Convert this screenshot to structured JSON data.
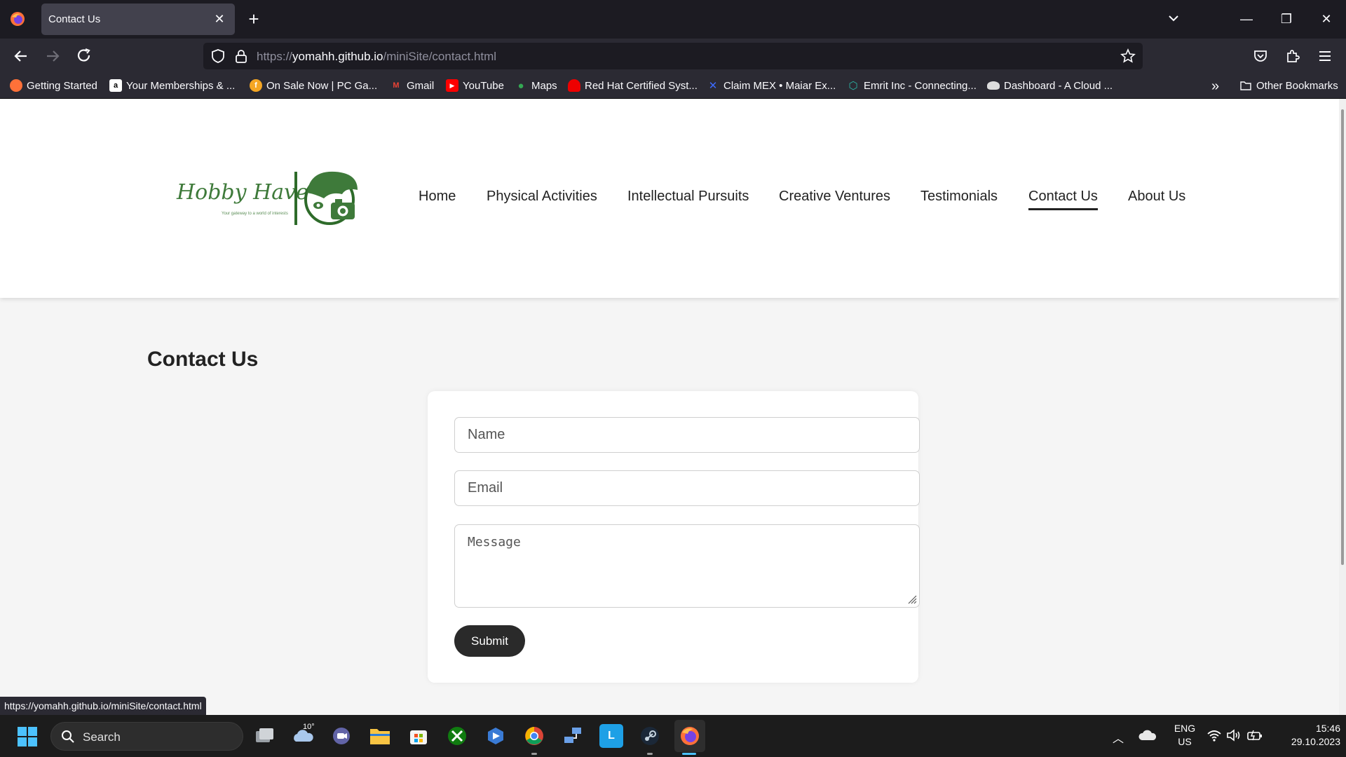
{
  "browser": {
    "tab_title": "Contact Us",
    "url_prefix": "https://",
    "url_host": "yomahh.github.io",
    "url_path": "/miniSite/contact.html",
    "bookmarks": [
      {
        "label": "Getting Started",
        "icon": "firefox-icon",
        "color": "#e66000"
      },
      {
        "label": "Your Memberships & ...",
        "icon": "amazon-icon",
        "color": "#ffffff"
      },
      {
        "label": "On Sale Now | PC Ga...",
        "icon": "store-icon",
        "color": "#f5a623"
      },
      {
        "label": "Gmail",
        "icon": "gmail-icon",
        "color": "#ea4335"
      },
      {
        "label": "YouTube",
        "icon": "youtube-icon",
        "color": "#ff0000"
      },
      {
        "label": "Maps",
        "icon": "maps-icon",
        "color": "#34a853"
      },
      {
        "label": "Red Hat Certified Syst...",
        "icon": "redhat-icon",
        "color": "#ee0000"
      },
      {
        "label": "Claim MEX • Maiar Ex...",
        "icon": "maiar-icon",
        "color": "#1a4fff"
      },
      {
        "label": "Emrit Inc - Connecting...",
        "icon": "emrit-icon",
        "color": "#2bb3a3"
      },
      {
        "label": "Dashboard - A Cloud ...",
        "icon": "cloud-icon",
        "color": "#dddddd"
      }
    ],
    "other_bookmarks": "Other Bookmarks",
    "status_url": "https://yomahh.github.io/miniSite/contact.html"
  },
  "site": {
    "logo_text": "Hobby Haven",
    "logo_tagline": "Your gateway to a world of interests",
    "nav": [
      {
        "label": "Home",
        "active": false
      },
      {
        "label": "Physical Activities",
        "active": false
      },
      {
        "label": "Intellectual Pursuits",
        "active": false
      },
      {
        "label": "Creative Ventures",
        "active": false
      },
      {
        "label": "Testimonials",
        "active": false
      },
      {
        "label": "Contact Us",
        "active": true
      },
      {
        "label": "About Us",
        "active": false
      }
    ],
    "page_title": "Contact Us",
    "form": {
      "name_placeholder": "Name",
      "email_placeholder": "Email",
      "message_placeholder": "Message",
      "submit_label": "Submit"
    },
    "brand_color": "#3e7a3a"
  },
  "taskbar": {
    "search_label": "Search",
    "weather_temp": "10°",
    "apps": [
      "task-view-icon",
      "weather-icon",
      "teams-icon",
      "file-explorer-icon",
      "ms-store-icon",
      "xbox-icon",
      "copilot-icon",
      "chrome-icon",
      "network-app-icon",
      "l-app-icon",
      "steam-icon",
      "firefox-icon"
    ],
    "lang_line1": "ENG",
    "lang_line2": "US",
    "time": "15:46",
    "date": "29.10.2023"
  }
}
